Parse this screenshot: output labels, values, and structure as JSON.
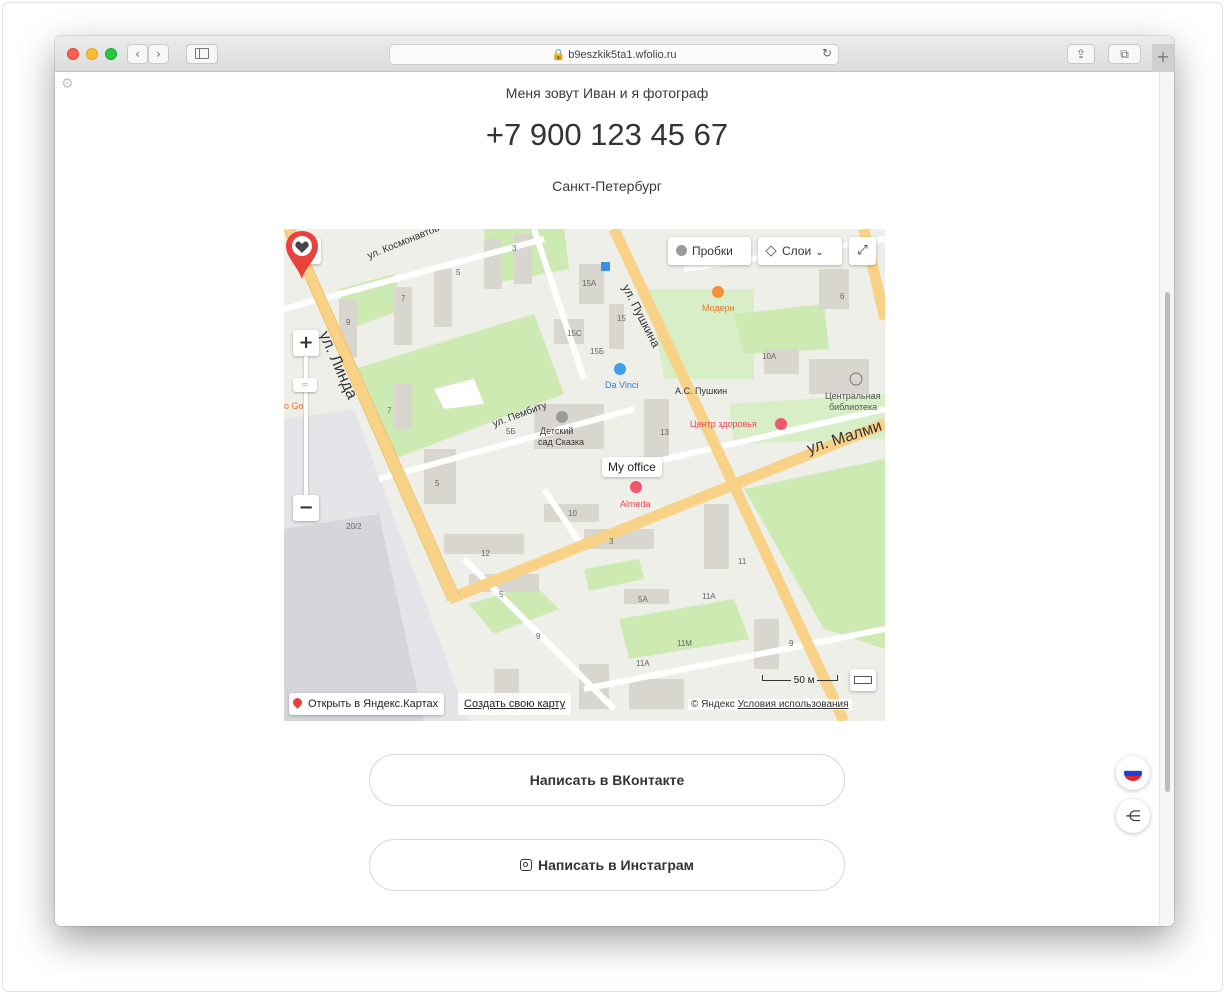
{
  "browser": {
    "url": "🔒 b9eszkik5ta1.wfolio.ru",
    "back_icon": "chevron-left-icon",
    "forward_icon": "chevron-right-icon",
    "sidebar_icon": "sidebar-icon",
    "reload_icon": "reload-icon",
    "share_icon": "share-icon",
    "tabs_icon": "tabs-icon",
    "new_tab_label": "+"
  },
  "page": {
    "intro": "Меня зовут Иван и я фотограф",
    "phone": "+7 900 123 45 67",
    "city": "Санкт-Петербург"
  },
  "map": {
    "traffic_label": "Пробки",
    "layers_label": "Слои",
    "zoom_in": "+",
    "zoom_out": "−",
    "marker_label": "My office",
    "open_in_yandex": "Открыть в Яндекс.Картах",
    "create_map": "Создать свою карту",
    "scale": "50 м",
    "copyright": "© Яндекс",
    "terms": "Условия использования",
    "streets": {
      "kosmonavtov": "ул. Космонавтов",
      "pushkina": "ул. Пушкина",
      "linda": "ул. Линда",
      "pembitu": "ул. Пембиту",
      "malmi": "ул. Малми"
    },
    "pois": {
      "modern": "Модерн",
      "davinci": "Da Vinci",
      "pushkin": "А.С. Пушкин",
      "library_1": "Центральная",
      "library_2": "библиотека",
      "health": "Центр здоровья",
      "kindergarten_1": "Детский",
      "kindergarten_2": "сад Сказка",
      "almeda": "Almeda",
      "go": "o Go"
    },
    "house_numbers": [
      "3",
      "5",
      "7",
      "9",
      "7",
      "15A",
      "15",
      "15С",
      "15Б",
      "10А",
      "13",
      "5Б",
      "5",
      "10",
      "12",
      "3",
      "11",
      "5А",
      "11А",
      "5",
      "9",
      "11М",
      "11А",
      "9",
      "20/2",
      "6"
    ]
  },
  "buttons": {
    "vk": "Написать в ВКонтакте",
    "instagram": "Написать в Инстаграм"
  },
  "colors": {
    "road_major": "#f8d287",
    "park": "#cdeab2",
    "building": "#d9d6cf",
    "pin": "#e8423f"
  }
}
